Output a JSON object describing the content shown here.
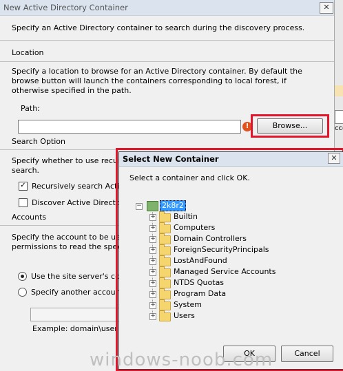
{
  "main_dialog": {
    "title": "New Active Directory Container",
    "close_glyph": "✕",
    "intro": "Specify an Active Directory container to search during the discovery process.",
    "location": {
      "heading": "Location",
      "description": "Specify a location to browse for an Active Directory container. By default the browse button will launch the containers corresponding to local forest, if otherwise specified in the path.",
      "path_label": "Path:",
      "path_value": "",
      "warning_glyph": "!",
      "browse_label": "Browse..."
    },
    "search_option": {
      "heading": "Search Option",
      "description_line1": "Specify whether to use recursive",
      "description_line2": "search.",
      "recursive_label": "Recursively search Active",
      "recursive_checked": true,
      "discover_label": "Discover Active Directory c",
      "discover_checked": false
    },
    "accounts": {
      "heading": "Accounts",
      "description_line1": "Specify the account to be used f",
      "description_line2": "permissions to read the specified",
      "use_site_server_label": "Use the site server's compu",
      "specify_another_label": "Specify another account:",
      "example": "Example: domain\\user"
    }
  },
  "right_strip": {
    "fragment": "ccou"
  },
  "select_container": {
    "title": "Select New Container",
    "close_glyph": "✕",
    "instruction": "Select a container and click OK.",
    "root": {
      "label": "2k8r2",
      "expander": "−"
    },
    "children": [
      {
        "label": "Builtin"
      },
      {
        "label": "Computers"
      },
      {
        "label": "Domain Controllers"
      },
      {
        "label": "ForeignSecurityPrincipals"
      },
      {
        "label": "LostAndFound"
      },
      {
        "label": "Managed Service Accounts"
      },
      {
        "label": "NTDS Quotas"
      },
      {
        "label": "Program Data"
      },
      {
        "label": "System"
      },
      {
        "label": "Users"
      }
    ],
    "child_expander": "+",
    "ok_label": "OK",
    "cancel_label": "Cancel"
  },
  "watermark": "windows-noob.com",
  "colors": {
    "highlight_box": "#e3152b",
    "selection": "#3399ff"
  }
}
